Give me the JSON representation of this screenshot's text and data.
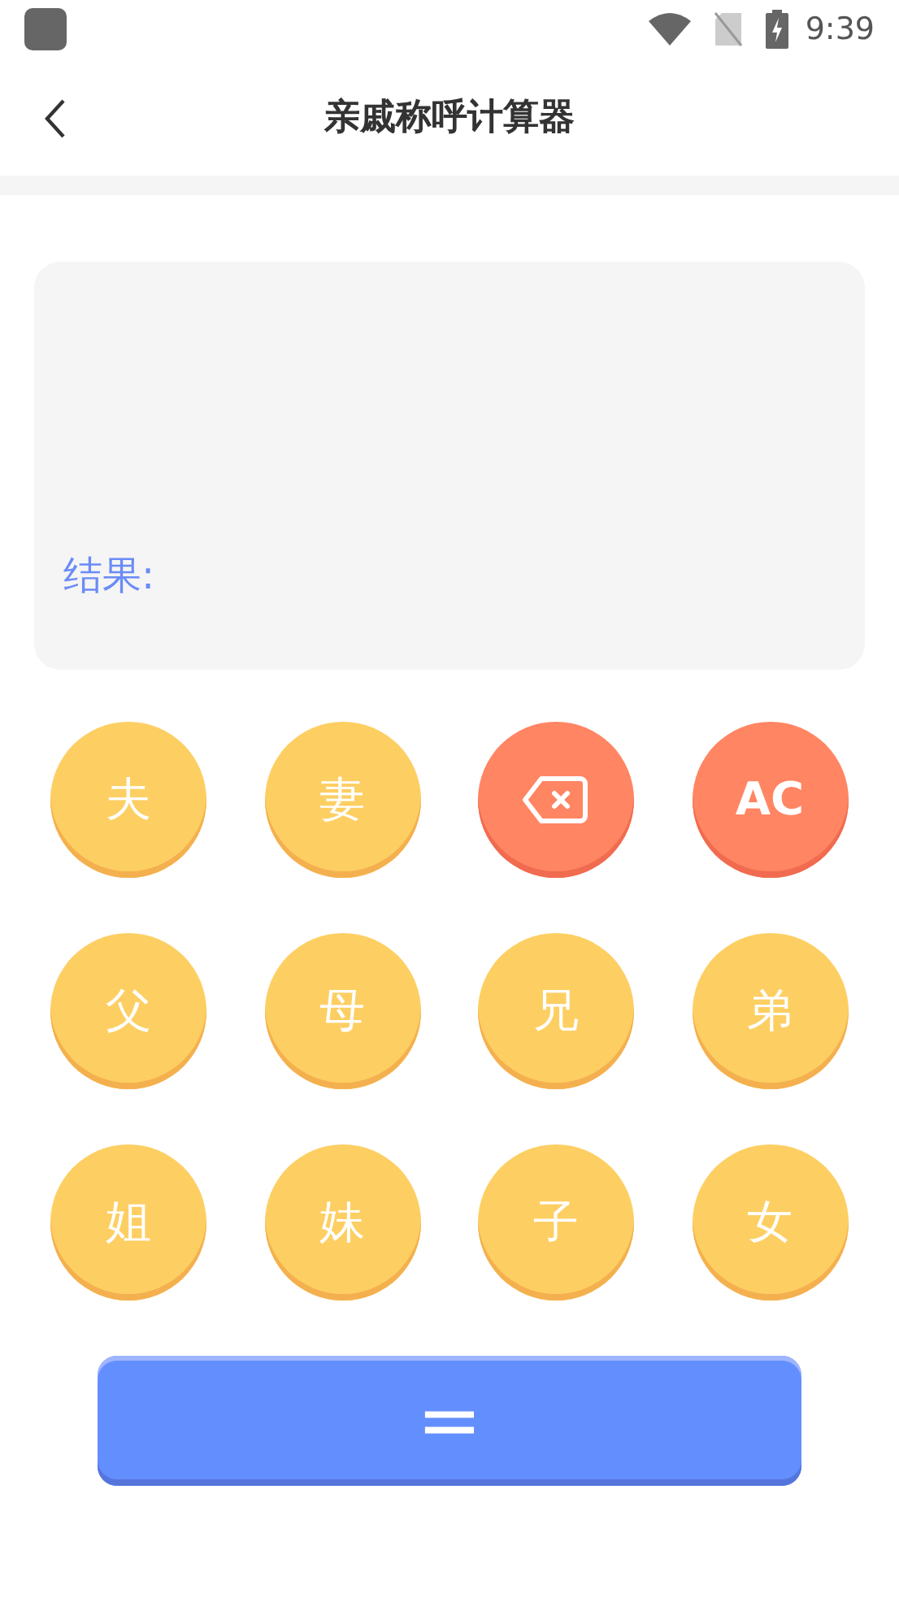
{
  "status_bar": {
    "time": "9:39"
  },
  "header": {
    "title": "亲戚称呼计算器"
  },
  "display": {
    "result_label": "结果:"
  },
  "keys": [
    {
      "kind": "relation",
      "label": "夫"
    },
    {
      "kind": "relation",
      "label": "妻"
    },
    {
      "kind": "backspace"
    },
    {
      "kind": "clear",
      "label": "AC"
    },
    {
      "kind": "relation",
      "label": "父"
    },
    {
      "kind": "relation",
      "label": "母"
    },
    {
      "kind": "relation",
      "label": "兄"
    },
    {
      "kind": "relation",
      "label": "弟"
    },
    {
      "kind": "relation",
      "label": "姐"
    },
    {
      "kind": "relation",
      "label": "妹"
    },
    {
      "kind": "relation",
      "label": "子"
    },
    {
      "kind": "relation",
      "label": "女"
    }
  ],
  "equals_button": {
    "label": "="
  }
}
